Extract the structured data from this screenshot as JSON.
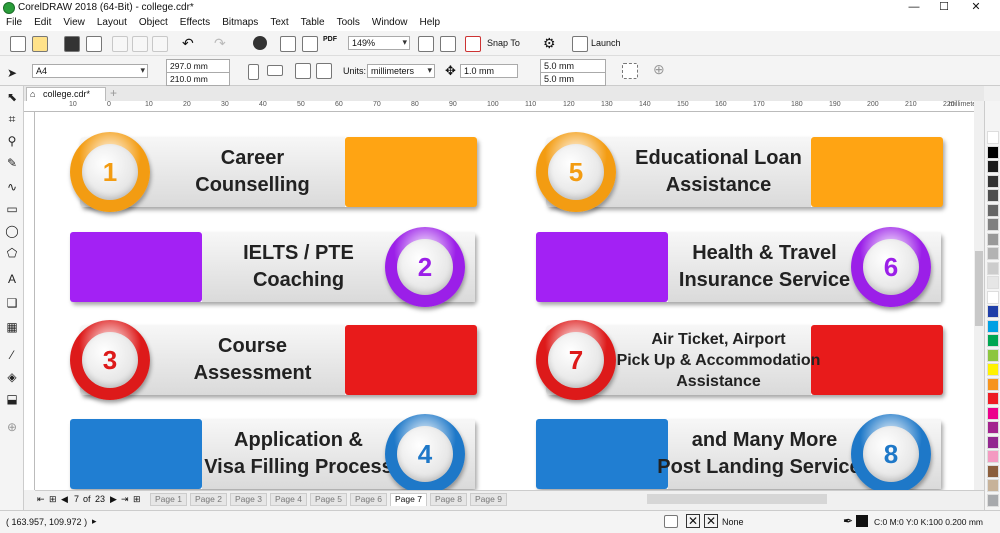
{
  "app": {
    "title": "CorelDRAW 2018 (64-Bit) - college.cdr*"
  },
  "menu": [
    "File",
    "Edit",
    "View",
    "Layout",
    "Object",
    "Effects",
    "Bitmaps",
    "Text",
    "Table",
    "Tools",
    "Window",
    "Help"
  ],
  "toolbar": {
    "zoom": "149%",
    "snap_label": "Snap To",
    "launch_label": "Launch"
  },
  "property_bar": {
    "page_size": "A4",
    "width": "297.0 mm",
    "height": "210.0 mm",
    "units_label": "Units:",
    "units": "millimeters",
    "nudge": "1.0 mm",
    "dup_x": "5.0 mm",
    "dup_y": "5.0 mm"
  },
  "document": {
    "tab": "college.cdr*"
  },
  "ruler": {
    "ticks": [
      "10",
      "0",
      "10",
      "20",
      "30",
      "40",
      "50",
      "60",
      "70",
      "80",
      "90",
      "100",
      "110",
      "120",
      "130",
      "140",
      "150",
      "160",
      "170",
      "180",
      "190",
      "200",
      "210",
      "220"
    ],
    "unit": "millimeters"
  },
  "infographic": {
    "items": [
      {
        "num": "1",
        "lines": [
          "Career",
          "Counselling"
        ],
        "color": "#f39c12"
      },
      {
        "num": "2",
        "lines": [
          "IELTS / PTE",
          "Coaching"
        ],
        "color": "#9b1fe8"
      },
      {
        "num": "3",
        "lines": [
          "Course",
          "Assessment"
        ],
        "color": "#dd1a1a"
      },
      {
        "num": "4",
        "lines": [
          "Application &",
          "Visa Filling Process"
        ],
        "color": "#1e78c8"
      },
      {
        "num": "5",
        "lines": [
          "Educational Loan",
          "Assistance"
        ],
        "color": "#f39c12"
      },
      {
        "num": "6",
        "lines": [
          "Health & Travel",
          "Insurance Service"
        ],
        "color": "#9b1fe8"
      },
      {
        "num": "7",
        "lines": [
          "Air Ticket, Airport",
          "Pick Up & Accommodation",
          "Assistance"
        ],
        "color": "#dd1a1a"
      },
      {
        "num": "8",
        "lines": [
          "and Many More",
          "Post Landing Services"
        ],
        "color": "#1e78c8"
      }
    ]
  },
  "page_nav": {
    "current": "7",
    "of": "of",
    "total": "23",
    "pages": [
      "Page 1",
      "Page 2",
      "Page 3",
      "Page 4",
      "Page 5",
      "Page 6",
      "Page 7",
      "Page 8",
      "Page 9"
    ],
    "active": "Page 7"
  },
  "status": {
    "coords": "( 163.957, 109.972 )",
    "fill": "None",
    "outline": "C:0 M:0 Y:0 K:100  0.200 mm"
  }
}
